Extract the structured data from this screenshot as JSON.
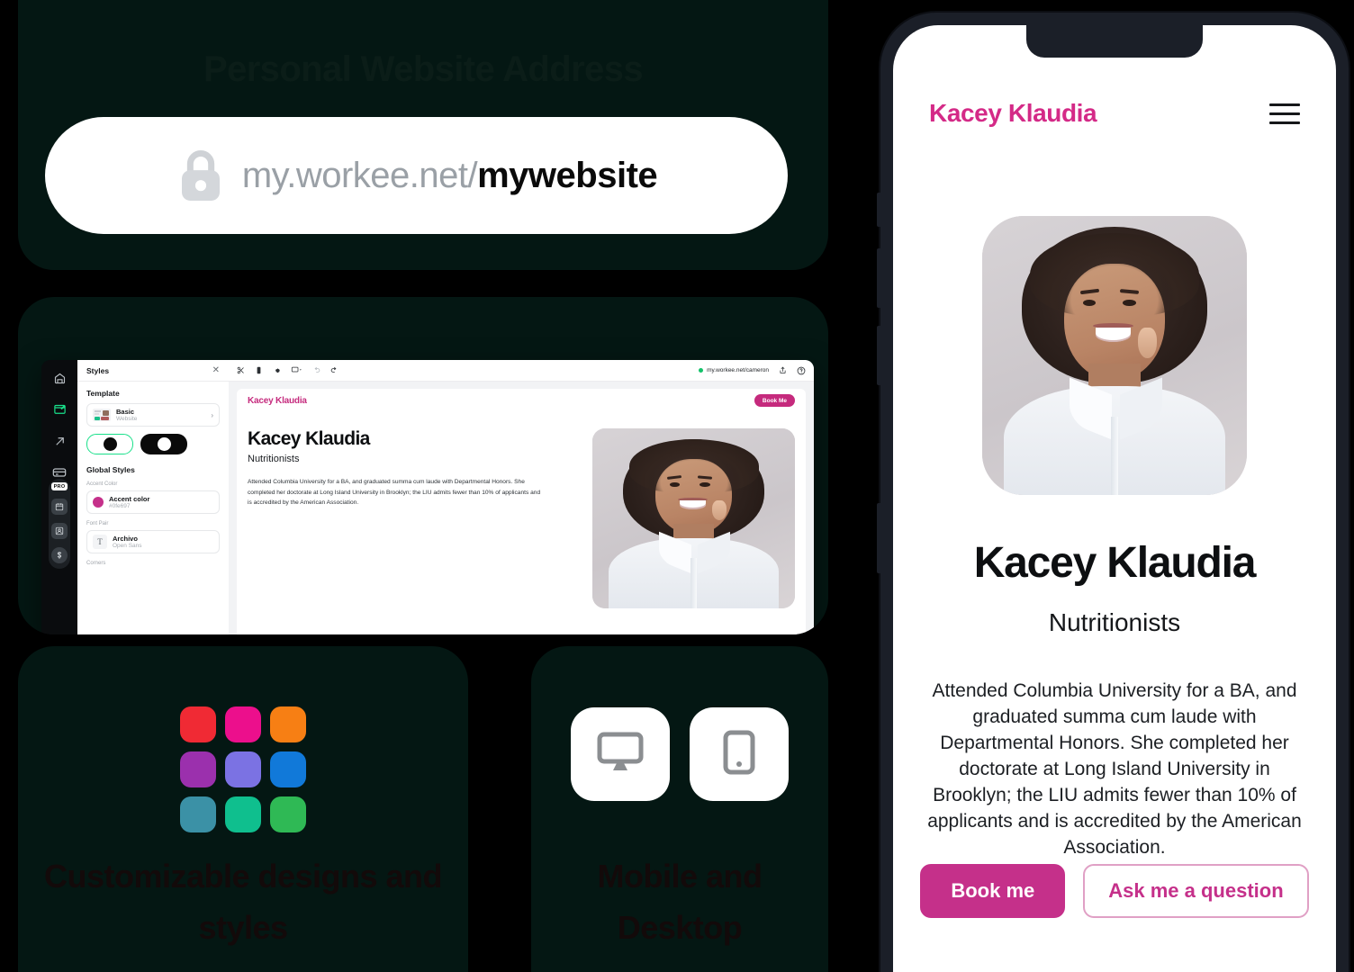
{
  "brand_colors": {
    "page_bg": "#000000",
    "card_bg": "#041713",
    "accent_pink": "#c5308a",
    "accent_green": "#19e08a"
  },
  "url_card": {
    "title": "Personal Website Address",
    "lock_icon": "lock-icon",
    "domain": "my.workee.net/",
    "slug": "mywebsite"
  },
  "editor_card": {
    "rail": {
      "items": [
        {
          "name": "workee-logo-icon",
          "label": "Workee"
        },
        {
          "name": "website-editor-icon",
          "label": "Website",
          "active": true
        },
        {
          "name": "share-arrow-icon",
          "label": "Share"
        },
        {
          "name": "card-icon",
          "label": "Payments"
        }
      ],
      "pro_badge": "PRO",
      "grouped": [
        {
          "name": "calendar-icon",
          "label": "Calendar"
        },
        {
          "name": "client-icon",
          "label": "Clients"
        },
        {
          "name": "dollar-icon",
          "label": "Earnings"
        }
      ]
    },
    "styles_panel": {
      "title": "Styles",
      "close_icon": "close-icon",
      "template_section": "Template",
      "template_name": "Basic",
      "template_type": "Website",
      "chevron": "chevron-right-icon",
      "theme_light": "light-theme-toggle",
      "theme_dark": "dark-theme-toggle",
      "global_section": "Global Styles",
      "accent_label": "Accent Color",
      "accent_name": "Accent color",
      "accent_hex": "#0fe697",
      "font_label": "Font Pair",
      "font_primary": "Archivo",
      "font_secondary": "Open Sans",
      "corners_label": "Corners"
    },
    "toolbar": {
      "icons": [
        "styles-icon",
        "mobile-preview-icon",
        "settings-gear-icon",
        "desktop-preview-icon",
        "undo-icon",
        "redo-icon"
      ],
      "status_dot": "published-dot",
      "url": "my.workee.net/cameron",
      "share_icon": "share-icon",
      "help_icon": "help-circle-icon"
    },
    "preview": {
      "brand": "Kacey Klaudia",
      "book_button": "Book Me",
      "heading": "Kacey Klaudia",
      "subheading": "Nutritionists",
      "bio": "Attended Columbia University for a BA, and graduated summa cum laude with Departmental Honors. She completed her doctorate at Long Island University in Brooklyn; the LIU admits fewer than 10% of applicants and is accredited by the American Association."
    }
  },
  "colors_card": {
    "title": "Customizable designs and styles",
    "swatches": [
      "#f02a34",
      "#ec0f8c",
      "#f77f14",
      "#9b30ad",
      "#7b72e3",
      "#1179d9",
      "#3b91a6",
      "#0fbf8e",
      "#2fb955"
    ]
  },
  "devices_card": {
    "title": "Mobile and Desktop",
    "desktop_icon": "desktop-monitor-icon",
    "mobile_icon": "mobile-phone-icon"
  },
  "phone_preview": {
    "brand": "Kacey Klaudia",
    "menu_icon": "hamburger-menu-icon",
    "avatar": "profile-photo",
    "heading": "Kacey Klaudia",
    "subheading": "Nutritionists",
    "bio": "Attended Columbia University for a BA, and graduated summa cum laude with Departmental Honors. She completed her doctorate at Long Island University in Brooklyn; the LIU admits fewer than 10% of applicants and is accredited by the American Association.",
    "primary_button": "Book me",
    "secondary_button": "Ask me a question"
  }
}
